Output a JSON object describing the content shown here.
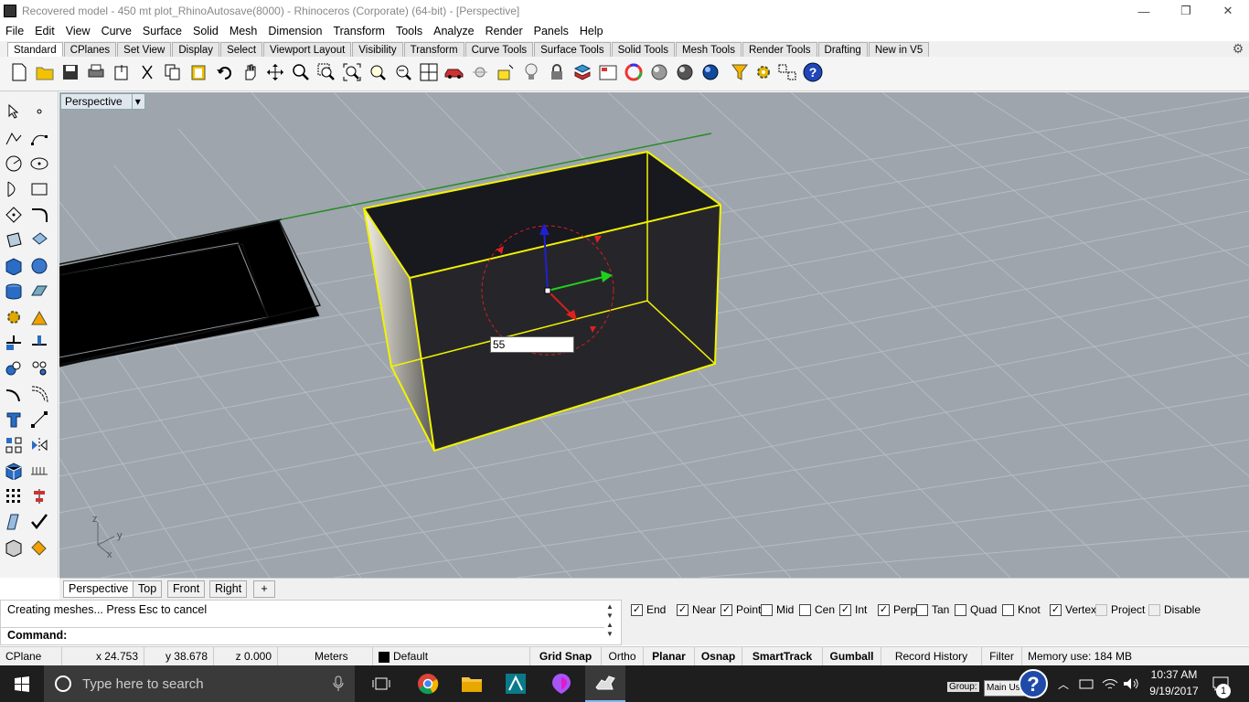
{
  "window": {
    "title": "Recovered model - 450 mt plot_RhinoAutosave(8000) - Rhinoceros (Corporate) (64-bit) - [Perspective]",
    "minimize": "—",
    "restore": "❐",
    "close": "✕"
  },
  "menu": [
    "File",
    "Edit",
    "View",
    "Curve",
    "Surface",
    "Solid",
    "Mesh",
    "Dimension",
    "Transform",
    "Tools",
    "Analyze",
    "Render",
    "Panels",
    "Help"
  ],
  "toolbar_tabs": [
    "Standard",
    "CPlanes",
    "Set View",
    "Display",
    "Select",
    "Viewport Layout",
    "Visibility",
    "Transform",
    "Curve Tools",
    "Surface Tools",
    "Solid Tools",
    "Mesh Tools",
    "Render Tools",
    "Drafting",
    "New in V5"
  ],
  "viewport": {
    "label": "Perspective",
    "dropdown": "▾",
    "gumball_input": "55",
    "axis_z": "z",
    "axis_y": "y",
    "axis_x": "x"
  },
  "viewport_tabs": [
    "Perspective",
    "Top",
    "Front",
    "Right"
  ],
  "viewport_add": "+",
  "command": {
    "history": "Creating meshes... Press Esc to cancel",
    "prompt": "Command:",
    "value": ""
  },
  "osnaps": [
    {
      "label": "End",
      "checked": true
    },
    {
      "label": "Near",
      "checked": true
    },
    {
      "label": "Point",
      "checked": true
    },
    {
      "label": "Mid",
      "checked": false
    },
    {
      "label": "Cen",
      "checked": false
    },
    {
      "label": "Int",
      "checked": true
    },
    {
      "label": "Perp",
      "checked": true
    },
    {
      "label": "Tan",
      "checked": false
    },
    {
      "label": "Quad",
      "checked": false
    },
    {
      "label": "Knot",
      "checked": false
    },
    {
      "label": "Vertex",
      "checked": true
    },
    {
      "label": "Project",
      "checked": false,
      "disabled": true
    },
    {
      "label": "Disable",
      "checked": false,
      "disabled": true
    }
  ],
  "status": {
    "cplane": "CPlane",
    "x": "x 24.753",
    "y": "y 38.678",
    "z": "z 0.000",
    "units": "Meters",
    "layer": "Default",
    "gridsnap": "Grid Snap",
    "ortho": "Ortho",
    "planar": "Planar",
    "osnap": "Osnap",
    "smarttrack": "SmartTrack",
    "gumball": "Gumball",
    "history": "Record History",
    "filter": "Filter",
    "memory": "Memory use: 184 MB"
  },
  "taskbar": {
    "search": "Type here to search",
    "time": "10:37 AM",
    "date": "9/19/2017",
    "group_label": "Group:",
    "group_value": "Main Us",
    "notif": "1"
  },
  "colors": {
    "viewport_bg": "#9ea5ad",
    "grid": "#b3b9bf",
    "selection": "#f2f200",
    "box_fill": "#26262a",
    "x_axis": "#2aa12a"
  }
}
